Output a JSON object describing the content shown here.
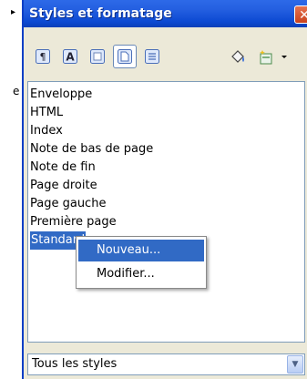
{
  "background_fragment": {
    "bullet": "▸",
    "stub_text": "e"
  },
  "window": {
    "title": "Styles et formatage",
    "close_glyph": "✕",
    "accent_color": "#0c49d2"
  },
  "toolbar": {
    "buttons": [
      {
        "name": "paragraph-styles",
        "icon": "paragraph-style-icon",
        "active": false
      },
      {
        "name": "character-styles",
        "icon": "character-style-icon",
        "active": false
      },
      {
        "name": "frame-styles",
        "icon": "frame-style-icon",
        "active": false
      },
      {
        "name": "page-styles",
        "icon": "page-style-icon",
        "active": true
      },
      {
        "name": "list-styles",
        "icon": "list-style-icon",
        "active": false
      },
      {
        "name": "fill-format-mode",
        "icon": "paint-bucket-icon",
        "active": false
      },
      {
        "name": "new-style-from-selection",
        "icon": "new-style-icon",
        "active": false
      },
      {
        "name": "style-actions-dropdown",
        "icon": "chevron-down-icon",
        "active": false
      }
    ]
  },
  "styles_list": {
    "items": [
      "Enveloppe",
      "HTML",
      "Index",
      "Note de bas de page",
      "Note de fin",
      "Page droite",
      "Page gauche",
      "Première page",
      "Standard"
    ],
    "selected": "Standard"
  },
  "context_menu": {
    "items": [
      {
        "label": "Nouveau...",
        "accel": "N",
        "highlighted": true
      },
      {
        "label": "Modifier...",
        "accel": "M",
        "highlighted": false
      }
    ]
  },
  "filter": {
    "value": "Tous les styles"
  }
}
